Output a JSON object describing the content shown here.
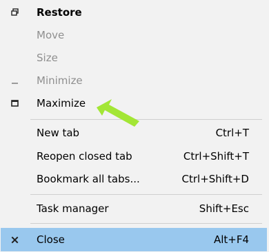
{
  "menu": {
    "items": [
      {
        "label": "Restore",
        "shortcut": "",
        "icon": "restore-icon",
        "state": "default"
      },
      {
        "label": "Move",
        "shortcut": "",
        "icon": "",
        "state": "disabled"
      },
      {
        "label": "Size",
        "shortcut": "",
        "icon": "",
        "state": "disabled"
      },
      {
        "label": "Minimize",
        "shortcut": "",
        "icon": "minimize-icon",
        "state": "disabled"
      },
      {
        "label": "Maximize",
        "shortcut": "",
        "icon": "maximize-icon",
        "state": "default"
      },
      {
        "label": "New tab",
        "shortcut": "Ctrl+T",
        "icon": "",
        "state": "default"
      },
      {
        "label": "Reopen closed tab",
        "shortcut": "Ctrl+Shift+T",
        "icon": "",
        "state": "default"
      },
      {
        "label": "Bookmark all tabs...",
        "shortcut": "Ctrl+Shift+D",
        "icon": "",
        "state": "default"
      },
      {
        "label": "Task manager",
        "shortcut": "Shift+Esc",
        "icon": "",
        "state": "default"
      },
      {
        "label": "Close",
        "shortcut": "Alt+F4",
        "icon": "close-icon",
        "state": "hovered"
      }
    ],
    "colors": {
      "background": "#f2f2f2",
      "disabled_text": "#8f8f8f",
      "hover_highlight": "#99c8ee",
      "annotation_arrow": "#a3e635"
    }
  }
}
